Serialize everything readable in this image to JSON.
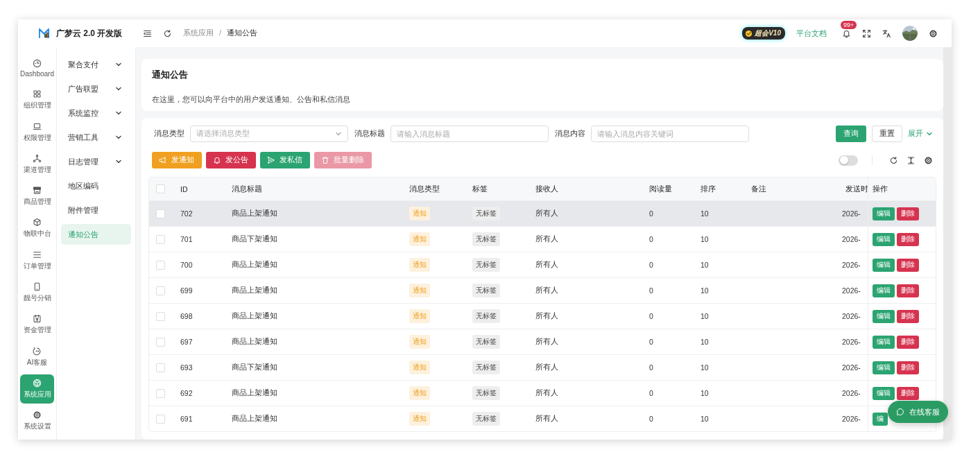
{
  "app": {
    "name": "广梦云 2.0 开发版"
  },
  "header": {
    "breadcrumb": [
      {
        "label": "系统应用",
        "current": false
      },
      {
        "label": "通知公告",
        "current": true
      }
    ],
    "separator": "/",
    "vip_badge": "超会V10",
    "docs_link": "平台文档",
    "notification_badge": "99+"
  },
  "rail": [
    {
      "label": "Dashboard",
      "kind": "dashboard",
      "selected": false
    },
    {
      "label": "组织管理",
      "kind": "org",
      "selected": false
    },
    {
      "label": "权限管理",
      "kind": "permission",
      "selected": false
    },
    {
      "label": "渠道管理",
      "kind": "channel",
      "selected": false
    },
    {
      "label": "商品管理",
      "kind": "product",
      "selected": false
    },
    {
      "label": "物联中台",
      "kind": "iot",
      "selected": false
    },
    {
      "label": "订单管理",
      "kind": "order",
      "selected": false
    },
    {
      "label": "靓号分销",
      "kind": "number",
      "selected": false
    },
    {
      "label": "资金管理",
      "kind": "finance",
      "selected": false
    },
    {
      "label": "AI客服",
      "kind": "ai",
      "selected": false
    },
    {
      "label": "系统应用",
      "kind": "apps",
      "selected": true
    },
    {
      "label": "系统设置",
      "kind": "settings",
      "selected": false
    }
  ],
  "submenu": [
    {
      "label": "聚合支付",
      "kind": "group",
      "selected": false
    },
    {
      "label": "广告联盟",
      "kind": "group",
      "selected": false
    },
    {
      "label": "系统监控",
      "kind": "group",
      "selected": false
    },
    {
      "label": "营销工具",
      "kind": "group",
      "selected": false
    },
    {
      "label": "日志管理",
      "kind": "group",
      "selected": false
    },
    {
      "label": "地区编码",
      "kind": "link",
      "selected": false
    },
    {
      "label": "附件管理",
      "kind": "link",
      "selected": false
    },
    {
      "label": "通知公告",
      "kind": "link",
      "selected": true
    }
  ],
  "page": {
    "title": "通知公告",
    "description": "在这里，您可以向平台中的用户发送通知、公告和私信消息"
  },
  "filters": [
    {
      "label": "消息类型",
      "kind": "select",
      "placeholder": "请选择消息类型"
    },
    {
      "label": "消息标题",
      "kind": "input",
      "placeholder": "请输入消息标题"
    },
    {
      "label": "消息内容",
      "kind": "input",
      "placeholder": "请输入消息内容关键词"
    }
  ],
  "filter_buttons": {
    "search": "查询",
    "reset": "重置",
    "expand": "展开"
  },
  "actions": [
    {
      "label": "发通知",
      "kind": "notice",
      "disabled": false
    },
    {
      "label": "发公告",
      "kind": "announce",
      "disabled": false
    },
    {
      "label": "发私信",
      "kind": "message",
      "disabled": false
    },
    {
      "label": "批量删除",
      "kind": "delete",
      "disabled": true
    }
  ],
  "table_tools": {
    "toggle_on": false
  },
  "table": {
    "all_checked": false,
    "columns": [
      "ID",
      "消息标题",
      "消息类型",
      "标签",
      "接收人",
      "阅读量",
      "排序",
      "备注",
      "发送时",
      "操作"
    ],
    "rows": [
      {
        "checked": false,
        "highlighted": true,
        "id": "702",
        "title": "商品上架通知",
        "type": "通知",
        "tag": "无标签",
        "receiver": "所有人",
        "reads": "0",
        "sort": "10",
        "send_time": "2026-",
        "actions": [
          {
            "label": "编辑",
            "kind": "edit"
          },
          {
            "label": "删除",
            "kind": "delete"
          }
        ]
      },
      {
        "checked": false,
        "highlighted": false,
        "id": "701",
        "title": "商品下架通知",
        "type": "通知",
        "tag": "无标签",
        "receiver": "所有人",
        "reads": "0",
        "sort": "10",
        "send_time": "2026-",
        "actions": [
          {
            "label": "编辑",
            "kind": "edit"
          },
          {
            "label": "删除",
            "kind": "delete"
          }
        ]
      },
      {
        "checked": false,
        "highlighted": false,
        "id": "700",
        "title": "商品上架通知",
        "type": "通知",
        "tag": "无标签",
        "receiver": "所有人",
        "reads": "0",
        "sort": "10",
        "send_time": "2026-",
        "actions": [
          {
            "label": "编辑",
            "kind": "edit"
          },
          {
            "label": "删除",
            "kind": "delete"
          }
        ]
      },
      {
        "checked": false,
        "highlighted": false,
        "id": "699",
        "title": "商品上架通知",
        "type": "通知",
        "tag": "无标签",
        "receiver": "所有人",
        "reads": "0",
        "sort": "10",
        "send_time": "2026-",
        "actions": [
          {
            "label": "编辑",
            "kind": "edit"
          },
          {
            "label": "删除",
            "kind": "delete"
          }
        ]
      },
      {
        "checked": false,
        "highlighted": false,
        "id": "698",
        "title": "商品上架通知",
        "type": "通知",
        "tag": "无标签",
        "receiver": "所有人",
        "reads": "0",
        "sort": "10",
        "send_time": "2026-",
        "actions": [
          {
            "label": "编辑",
            "kind": "edit"
          },
          {
            "label": "删除",
            "kind": "delete"
          }
        ]
      },
      {
        "checked": false,
        "highlighted": false,
        "id": "697",
        "title": "商品上架通知",
        "type": "通知",
        "tag": "无标签",
        "receiver": "所有人",
        "reads": "0",
        "sort": "10",
        "send_time": "2026-",
        "actions": [
          {
            "label": "编辑",
            "kind": "edit"
          },
          {
            "label": "删除",
            "kind": "delete"
          }
        ]
      },
      {
        "checked": false,
        "highlighted": false,
        "id": "693",
        "title": "商品下架通知",
        "type": "通知",
        "tag": "无标签",
        "receiver": "所有人",
        "reads": "0",
        "sort": "10",
        "send_time": "2026-",
        "actions": [
          {
            "label": "编辑",
            "kind": "edit"
          },
          {
            "label": "删除",
            "kind": "delete"
          }
        ]
      },
      {
        "checked": false,
        "highlighted": false,
        "id": "692",
        "title": "商品上架通知",
        "type": "通知",
        "tag": "无标签",
        "receiver": "所有人",
        "reads": "0",
        "sort": "10",
        "send_time": "2026-",
        "actions": [
          {
            "label": "编辑",
            "kind": "edit"
          },
          {
            "label": "删除",
            "kind": "delete"
          }
        ]
      },
      {
        "checked": false,
        "highlighted": false,
        "id": "691",
        "title": "商品上架通知",
        "type": "通知",
        "tag": "无标签",
        "receiver": "所有人",
        "reads": "0",
        "sort": "10",
        "send_time": "2026-",
        "actions": [
          {
            "label": "编",
            "kind": "edit"
          }
        ]
      }
    ]
  },
  "chat_button": {
    "label": "在线客服"
  }
}
